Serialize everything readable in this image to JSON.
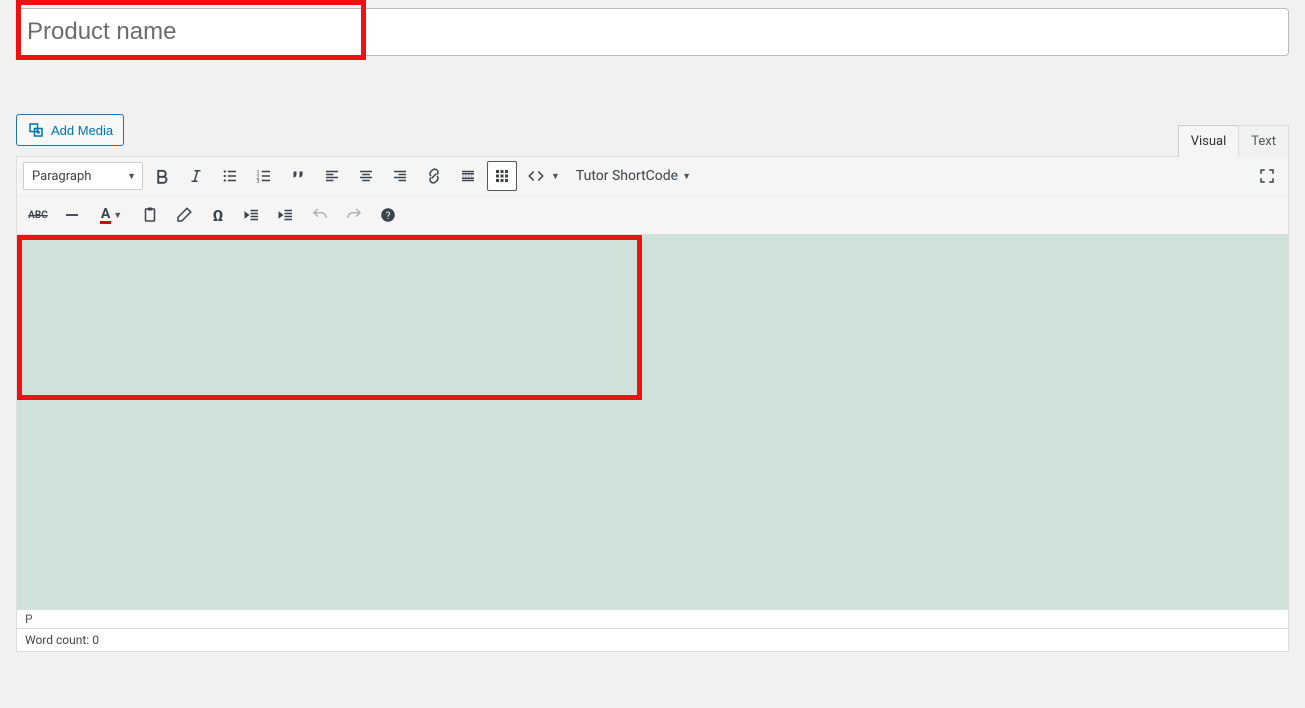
{
  "title": {
    "placeholder": "Product name"
  },
  "addMedia": {
    "label": "Add Media"
  },
  "tabs": {
    "visual": "Visual",
    "text": "Text",
    "active": "visual"
  },
  "toolbar": {
    "formatSelect": "Paragraph",
    "shortcode": "Tutor ShortCode",
    "textcolor_letter": "A"
  },
  "path": "P",
  "status": {
    "wordcount_label": "Word count: ",
    "wordcount": "0"
  }
}
